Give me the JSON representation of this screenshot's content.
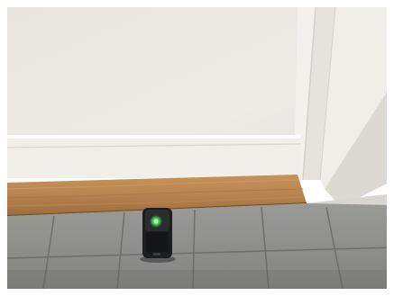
{
  "image": {
    "kind": "photograph",
    "subject": "small-black-device-with-green-led-on-tile-floor",
    "colors": {
      "wall": "#ece9e4",
      "door_panel": "#ebe7e1",
      "baseboard": "#f1efea",
      "wood_threshold": "#b9854e",
      "tile": "#8f8f8c",
      "grout": "#6e6e6b",
      "device_body": "#1c1d1f",
      "led": "#39d14a"
    }
  }
}
